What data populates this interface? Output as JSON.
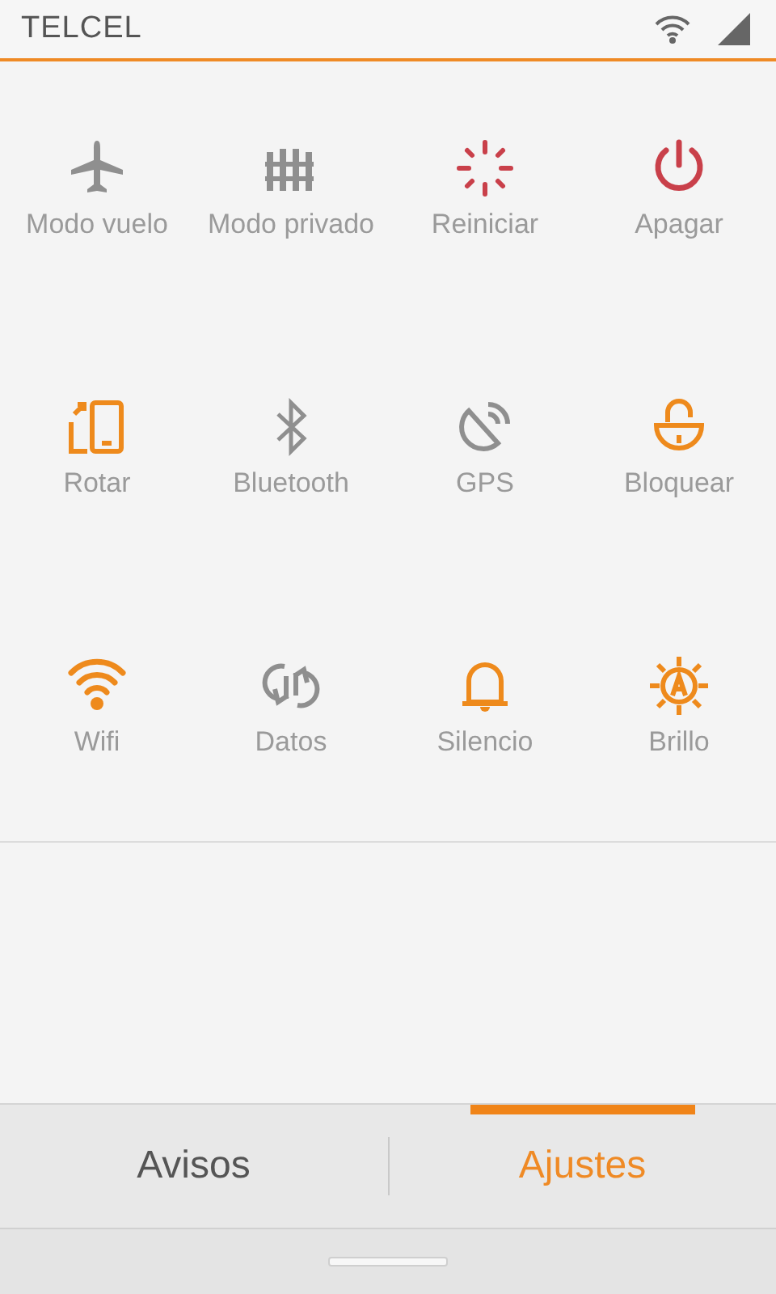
{
  "status_bar": {
    "carrier": "TELCEL"
  },
  "toggles": [
    {
      "label": "Modo vuelo",
      "kind": "airplane",
      "on": false
    },
    {
      "label": "Modo privado",
      "kind": "fence",
      "on": false
    },
    {
      "label": "Reiniciar",
      "kind": "restart"
    },
    {
      "label": "Apagar",
      "kind": "power"
    },
    {
      "label": "Rotar",
      "kind": "rotate",
      "on": true
    },
    {
      "label": "Bluetooth",
      "kind": "bluetooth",
      "on": false
    },
    {
      "label": "GPS",
      "kind": "gps",
      "on": false
    },
    {
      "label": "Bloquear",
      "kind": "lock",
      "on": true
    },
    {
      "label": "Wifi",
      "kind": "wifi",
      "on": true
    },
    {
      "label": "Datos",
      "kind": "data",
      "on": false
    },
    {
      "label": "Silencio",
      "kind": "bell",
      "on": true
    },
    {
      "label": "Brillo",
      "kind": "brightness",
      "on": true
    }
  ],
  "tabs": [
    {
      "label": "Avisos",
      "selected": false
    },
    {
      "label": "Ajustes",
      "selected": true
    }
  ]
}
